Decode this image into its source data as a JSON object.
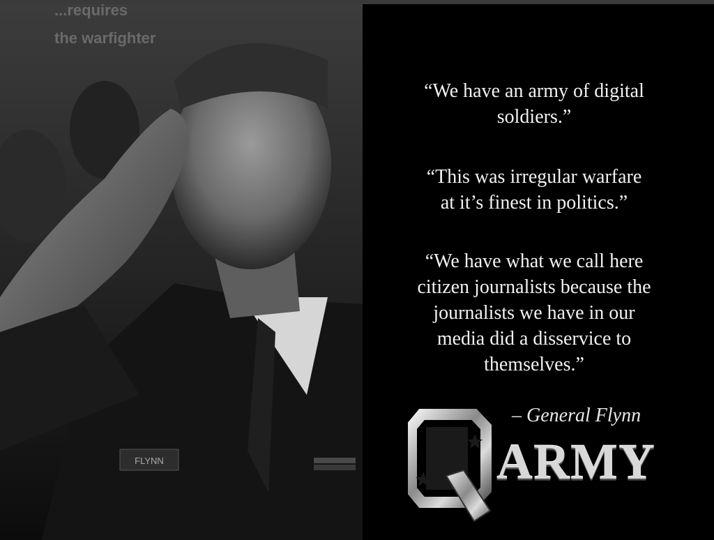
{
  "quotes": [
    "“We have an army of digital\nsoldiers.”",
    "“This was irregular warfare\nat it’s finest in politics.”",
    "“We have what we call here\ncitizen journalists because the\njournalists we have in our\nmedia did a disservice to\nthemselves.”"
  ],
  "attribution": "– General Flynn",
  "logo": {
    "letter": "Q",
    "word": "ARMY"
  },
  "photo": {
    "nametag": "FLYNN",
    "background_text": [
      "...requires",
      "the warfighter"
    ]
  },
  "colors": {
    "background": "#000000",
    "text": "#f2f2f2"
  }
}
